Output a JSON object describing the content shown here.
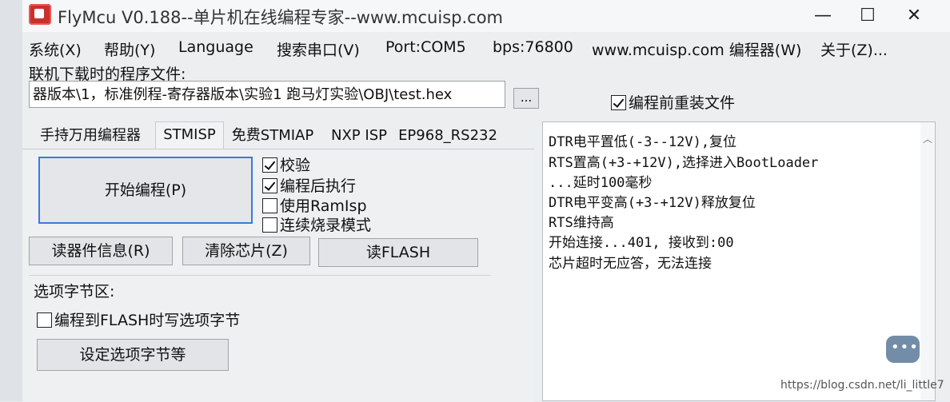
{
  "title": "FlyMcu V0.188--单片机在线编程专家--www.mcuisp.com",
  "window_controls": {
    "minimize": "—",
    "maximize": "☐",
    "close": "✕"
  },
  "menu": [
    {
      "label": "系统(X)"
    },
    {
      "label": "帮助(Y)"
    },
    {
      "label": "Language"
    },
    {
      "label": "搜索串口(V)"
    },
    {
      "label": "Port:COM5"
    },
    {
      "label": "bps:76800"
    },
    {
      "label": "www.mcuisp.com 编程器(W)"
    },
    {
      "label": "关于(Z)..."
    }
  ],
  "file": {
    "label": "联机下载时的程序文件:",
    "value": "器版本\\1，标准例程-寄存器版本\\实验1 跑马灯实验\\OBJ\\test.hex",
    "browse": "...",
    "reload_label": "编程前重装文件",
    "reload_checked": true
  },
  "tabs": [
    {
      "label": "手持万用编程器"
    },
    {
      "label": "STMISP"
    },
    {
      "label": "免费STMIAP"
    },
    {
      "label": "NXP ISP"
    },
    {
      "label": "EP968_RS232"
    }
  ],
  "actions": {
    "start_program": "开始编程(P)",
    "read_info": "读器件信息(R)",
    "erase_chip": "清除芯片(Z)",
    "read_flash": "读FLASH",
    "set_options": "设定选项字节等"
  },
  "options": [
    {
      "label": "校验",
      "checked": true
    },
    {
      "label": "编程后执行",
      "checked": true
    },
    {
      "label": "使用RamIsp",
      "checked": false
    },
    {
      "label": "连续烧录模式",
      "checked": false
    }
  ],
  "option_bytes": {
    "group_label": "选项字节区:",
    "write_label": "编程到FLASH时写选项字节",
    "write_checked": false
  },
  "log": [
    "DTR电平置低(-3--12V),复位",
    "RTS置高(+3-+12V),选择进入BootLoader",
    "...延时100毫秒",
    "DTR电平变高(+3-+12V)释放复位",
    "RTS维持高",
    "开始连接...401, 接收到:00",
    "芯片超时无应答，无法连接"
  ],
  "watermark": "https://blog.csdn.net/li_little7"
}
